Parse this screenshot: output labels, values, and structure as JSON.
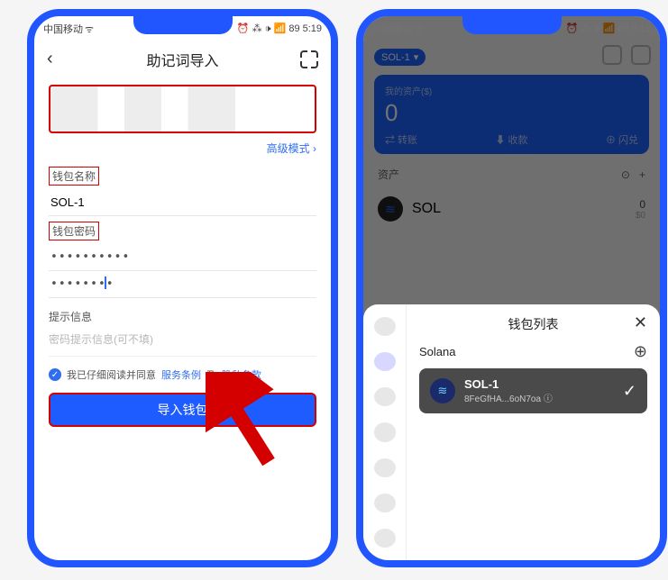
{
  "status": {
    "carrier": "中国移动",
    "signal": "ᯤ",
    "icons_right": "⏰ ⁂ 🕩 📶",
    "battery": "89",
    "time": "5:19"
  },
  "left": {
    "title": "助记词导入",
    "advanced": "高级模式 ›",
    "label_name": "钱包名称",
    "wallet_name": "SOL-1",
    "label_pw": "钱包密码",
    "pw1": "••••••••••",
    "pw2": "••••••••",
    "hint_section": "提示信息",
    "hint_placeholder": "密码提示信息(可不填)",
    "agree_pre": "我已仔细阅读并同意",
    "terms": "服务条例",
    "and": "及",
    "privacy": "隐私条款",
    "import_btn": "导入钱包"
  },
  "right": {
    "wallet_chip": "SOL-1",
    "balance_label": "我的资产($)",
    "balance_value": "0",
    "act_transfer": "⇄ 转账",
    "act_receive": "⬇ 收款",
    "act_scan": "⊕ 闪兑",
    "assets_label": "资产",
    "asset_symbol": "SOL",
    "asset_amount": "0",
    "asset_sub": "$0",
    "sheet_title": "钱包列表",
    "chain_name": "Solana",
    "wallet_name": "SOL-1",
    "wallet_addr": "8FeGfHA...6oN7oa ⓘ"
  }
}
